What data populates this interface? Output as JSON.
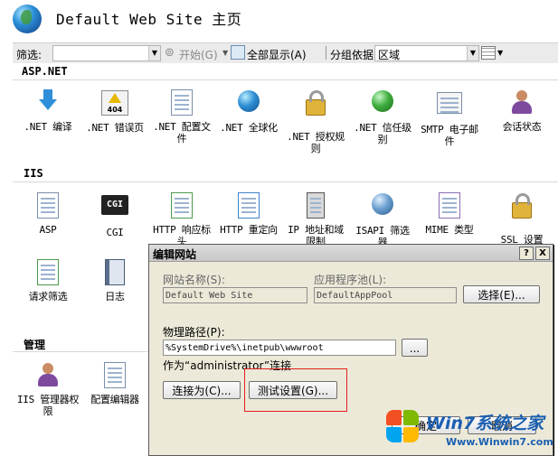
{
  "header": {
    "title": "Default Web Site 主页"
  },
  "filter_bar": {
    "filter_label": "筛选:",
    "start_label": "开始(G)",
    "show_all_label": "全部显示(A)",
    "group_label": "分组依据:",
    "group_value": "区域"
  },
  "sections": {
    "aspnet": {
      "title": "ASP.NET",
      "items": [
        {
          "label": ".NET 编译",
          "icon": "download-arrow-icon"
        },
        {
          "label": ".NET 错误页",
          "icon": "error-404-icon"
        },
        {
          "label": ".NET 配置文件",
          "icon": "config-file-icon"
        },
        {
          "label": ".NET 全球化",
          "icon": "globe-icon"
        },
        {
          "label": ".NET 授权规则",
          "icon": "authorization-lock-icon"
        },
        {
          "label": ".NET 信任级别",
          "icon": "trust-level-globe-icon"
        },
        {
          "label": "SMTP 电子邮件",
          "icon": "email-icon"
        },
        {
          "label": "会话状态",
          "icon": "session-state-icon"
        }
      ]
    },
    "iis": {
      "title": "IIS",
      "items": [
        {
          "label": "ASP",
          "icon": "asp-icon"
        },
        {
          "label": "CGI",
          "icon": "cgi-icon"
        },
        {
          "label": "HTTP 响应标头",
          "icon": "http-headers-icon"
        },
        {
          "label": "HTTP 重定向",
          "icon": "http-redirect-icon"
        },
        {
          "label": "IP 地址和域限制",
          "icon": "ip-restrictions-icon"
        },
        {
          "label": "ISAPI 筛选器",
          "icon": "isapi-filters-icon"
        },
        {
          "label": "MIME 类型",
          "icon": "mime-types-icon"
        },
        {
          "label": "SSL 设置",
          "icon": "ssl-lock-icon"
        },
        {
          "label": "请求筛选",
          "icon": "request-filtering-icon"
        },
        {
          "label": "日志",
          "icon": "logging-icon"
        }
      ]
    },
    "mgmt": {
      "title": "管理",
      "items": [
        {
          "label": "IIS 管理器权限",
          "icon": "users-permissions-icon"
        },
        {
          "label": "配置编辑器",
          "icon": "config-editor-icon"
        }
      ]
    }
  },
  "dialog": {
    "title": "编辑网站",
    "site_name_label": "网站名称(S):",
    "site_name_value": "Default Web Site",
    "app_pool_label": "应用程序池(L):",
    "app_pool_value": "DefaultAppPool",
    "select_button": "选择(E)...",
    "physical_path_label": "物理路径(P):",
    "physical_path_value": "%SystemDrive%\\inetpub\\wwwroot",
    "browse_button": "...",
    "connect_as_text": "作为“administrator”连接",
    "connect_as_button": "连接为(C)...",
    "test_settings_button": "测试设置(G)...",
    "ok_button": "确定",
    "cancel_button": "取消",
    "help_button": "?",
    "close_button": "X"
  },
  "watermark": {
    "title": "Win7系统之家",
    "url": "Www.Winwin7.com"
  }
}
